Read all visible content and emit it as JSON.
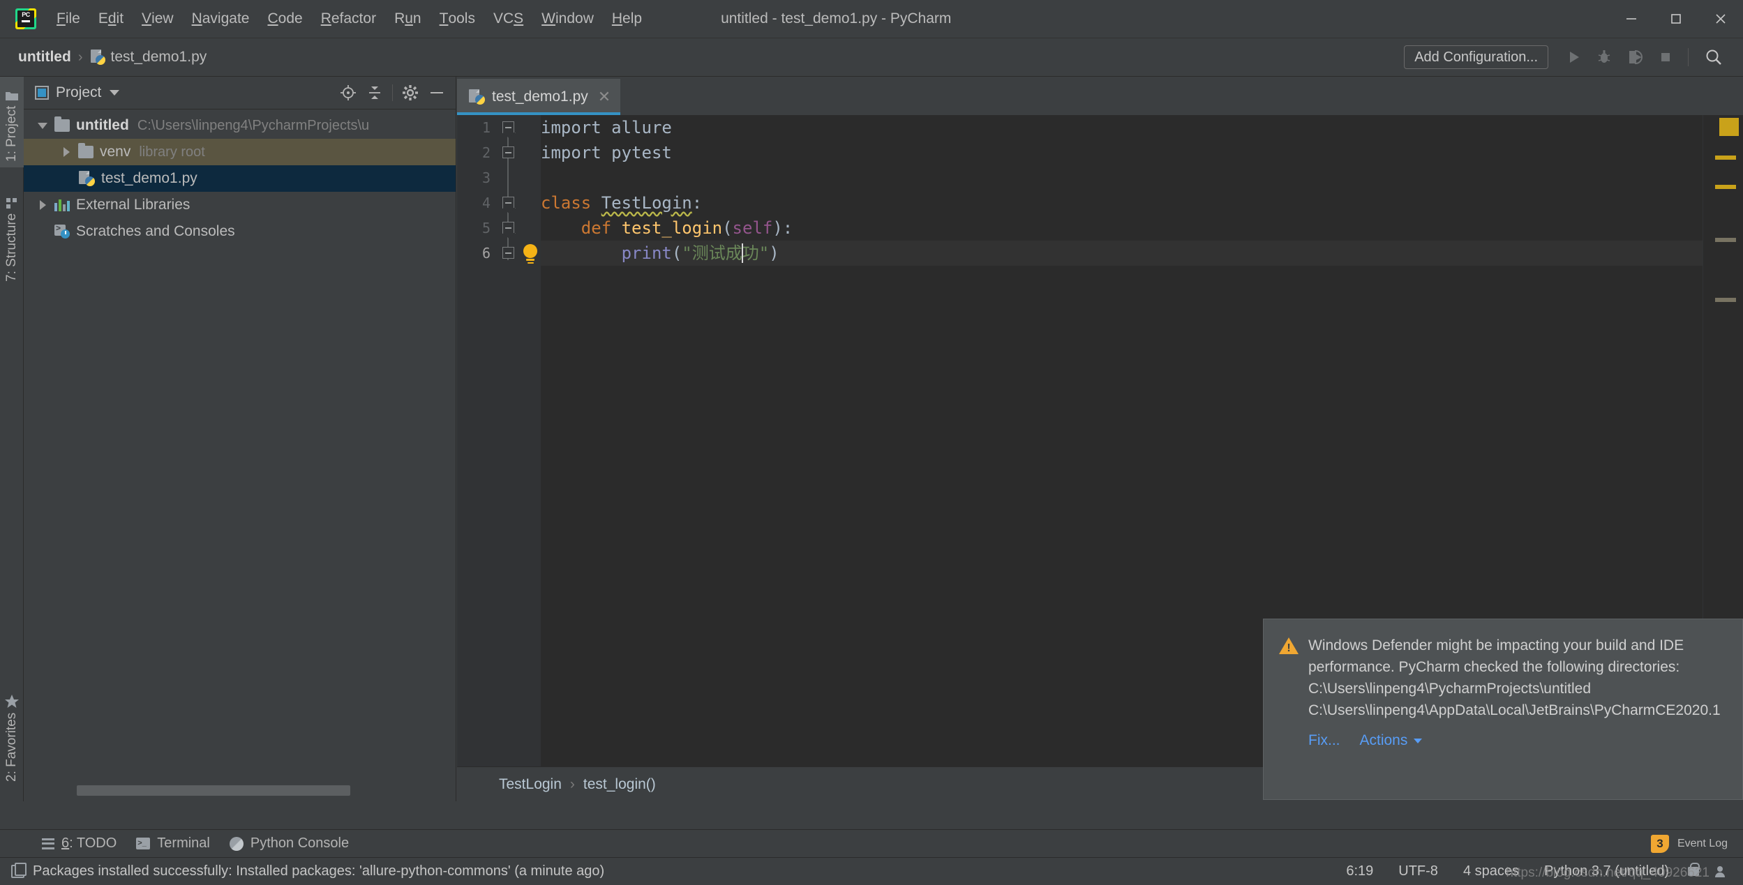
{
  "window": {
    "title": "untitled - test_demo1.py - PyCharm",
    "minimize": "─",
    "maximize": "❑",
    "close": "✕"
  },
  "menu": [
    {
      "label": "File",
      "mnemonic": "F"
    },
    {
      "label": "Edit",
      "mnemonic": "E"
    },
    {
      "label": "View",
      "mnemonic": "V"
    },
    {
      "label": "Navigate",
      "mnemonic": "N"
    },
    {
      "label": "Code",
      "mnemonic": "C"
    },
    {
      "label": "Refactor",
      "mnemonic": "R"
    },
    {
      "label": "Run",
      "mnemonic": "u"
    },
    {
      "label": "Tools",
      "mnemonic": "T"
    },
    {
      "label": "VCS",
      "mnemonic": "S"
    },
    {
      "label": "Window",
      "mnemonic": "W"
    },
    {
      "label": "Help",
      "mnemonic": "H"
    }
  ],
  "navbar": {
    "crumb_project": "untitled",
    "crumb_sep": "›",
    "crumb_file": "test_demo1.py",
    "add_configuration": "Add Configuration...",
    "run_icon": "run-icon",
    "debug_icon": "debug-icon",
    "coverage_icon": "run-with-coverage-icon",
    "stop_icon": "stop-icon",
    "search_icon": "search-everywhere-icon"
  },
  "stripe": {
    "project": "1: Project",
    "structure": "7: Structure",
    "favorites": "2: Favorites"
  },
  "project_panel": {
    "title": "Project",
    "tools": [
      "locate-icon",
      "collapse-all-icon",
      "settings-gear-icon",
      "hide-icon"
    ],
    "tree": [
      {
        "label": "untitled",
        "sub": "C:\\Users\\linpeng4\\PycharmProjects\\u",
        "icon": "folder-icon",
        "twisty": "down",
        "depth": 0,
        "bold": true,
        "state": "none"
      },
      {
        "label": "venv",
        "sub": "library root",
        "icon": "folder-icon",
        "twisty": "right",
        "depth": 1,
        "bold": false,
        "state": "sel-inactive"
      },
      {
        "label": "test_demo1.py",
        "sub": "",
        "icon": "python-file-icon",
        "twisty": "none",
        "depth": 1,
        "bold": false,
        "state": "sel-active"
      },
      {
        "label": "External Libraries",
        "sub": "",
        "icon": "libraries-icon",
        "twisty": "right",
        "depth": 0,
        "bold": false,
        "state": "none"
      },
      {
        "label": "Scratches and Consoles",
        "sub": "",
        "icon": "scratches-icon",
        "twisty": "none",
        "depth": 0,
        "bold": false,
        "state": "none"
      }
    ]
  },
  "editor": {
    "tab": {
      "label": "test_demo1.py",
      "icon": "python-file-icon",
      "close": "✕"
    },
    "lines": [
      {
        "n": "1",
        "fold": "top",
        "highlight": false,
        "bulb": false,
        "tokens": [
          {
            "t": "import ",
            "c": "pl"
          },
          {
            "t": "allure",
            "c": "pl"
          }
        ]
      },
      {
        "n": "2",
        "fold": "mid",
        "highlight": false,
        "bulb": false,
        "tokens": [
          {
            "t": "import ",
            "c": "pl"
          },
          {
            "t": "pytest",
            "c": "pl"
          }
        ]
      },
      {
        "n": "3",
        "fold": "none",
        "highlight": false,
        "bulb": false,
        "tokens": []
      },
      {
        "n": "4",
        "fold": "top",
        "highlight": false,
        "bulb": false,
        "tokens": [
          {
            "t": "class ",
            "c": "kw"
          },
          {
            "t": "TestLogin",
            "c": "cls wavy"
          },
          {
            "t": ":",
            "c": "pl"
          }
        ]
      },
      {
        "n": "5",
        "fold": "top",
        "highlight": false,
        "bulb": false,
        "tokens": [
          {
            "t": "    ",
            "c": "pl"
          },
          {
            "t": "def ",
            "c": "kw"
          },
          {
            "t": "test_login",
            "c": "fn"
          },
          {
            "t": "(",
            "c": "pl"
          },
          {
            "t": "self",
            "c": "self"
          },
          {
            "t": "):",
            "c": "pl"
          }
        ]
      },
      {
        "n": "6",
        "fold": "mid",
        "highlight": true,
        "bulb": true,
        "tokens": [
          {
            "t": "        ",
            "c": "pl"
          },
          {
            "t": "print",
            "c": "bi"
          },
          {
            "t": "(",
            "c": "pl"
          },
          {
            "t": "\"测试成功\"",
            "c": "str"
          },
          {
            "t": ")",
            "c": "pl"
          }
        ]
      }
    ],
    "breadcrumb": {
      "class": "TestLogin",
      "sep": "›",
      "method": "test_login()"
    }
  },
  "notification": {
    "icon": "warning-icon",
    "text": "Windows Defender might be impacting your build and IDE performance. PyCharm checked the following directories: C:\\Users\\linpeng4\\PycharmProjects\\untitled C:\\Users\\linpeng4\\AppData\\Local\\JetBrains\\PyCharmCE2020.1",
    "fix_label": "Fix...",
    "actions_label": "Actions"
  },
  "bottom_toolbar": {
    "todo": "6: TODO",
    "todo_mnemonic": "6",
    "terminal": "Terminal",
    "python_console": "Python Console",
    "event_log": "Event Log",
    "event_log_count": "3"
  },
  "statusbar": {
    "message": "Packages installed successfully: Installed packages: 'allure-python-commons' (a minute ago)",
    "caret_position": "6:19",
    "encoding": "UTF-8",
    "indent": "4 spaces",
    "interpreter": "Python 3.7 (untitled)",
    "lock_icon": "lock-icon",
    "person_icon": "user-icon",
    "watermark": "https://blog.csdn.net/qq_40926621"
  },
  "colors": {
    "accent": "#3592c4",
    "keyword": "#cc7832",
    "function": "#ffc66d",
    "string": "#6a8759",
    "self": "#94558d",
    "builtin": "#8888c6",
    "warning": "#f0a732",
    "link": "#589df6",
    "editor_bg": "#2b2b2b",
    "panel_bg": "#3c3f41"
  }
}
